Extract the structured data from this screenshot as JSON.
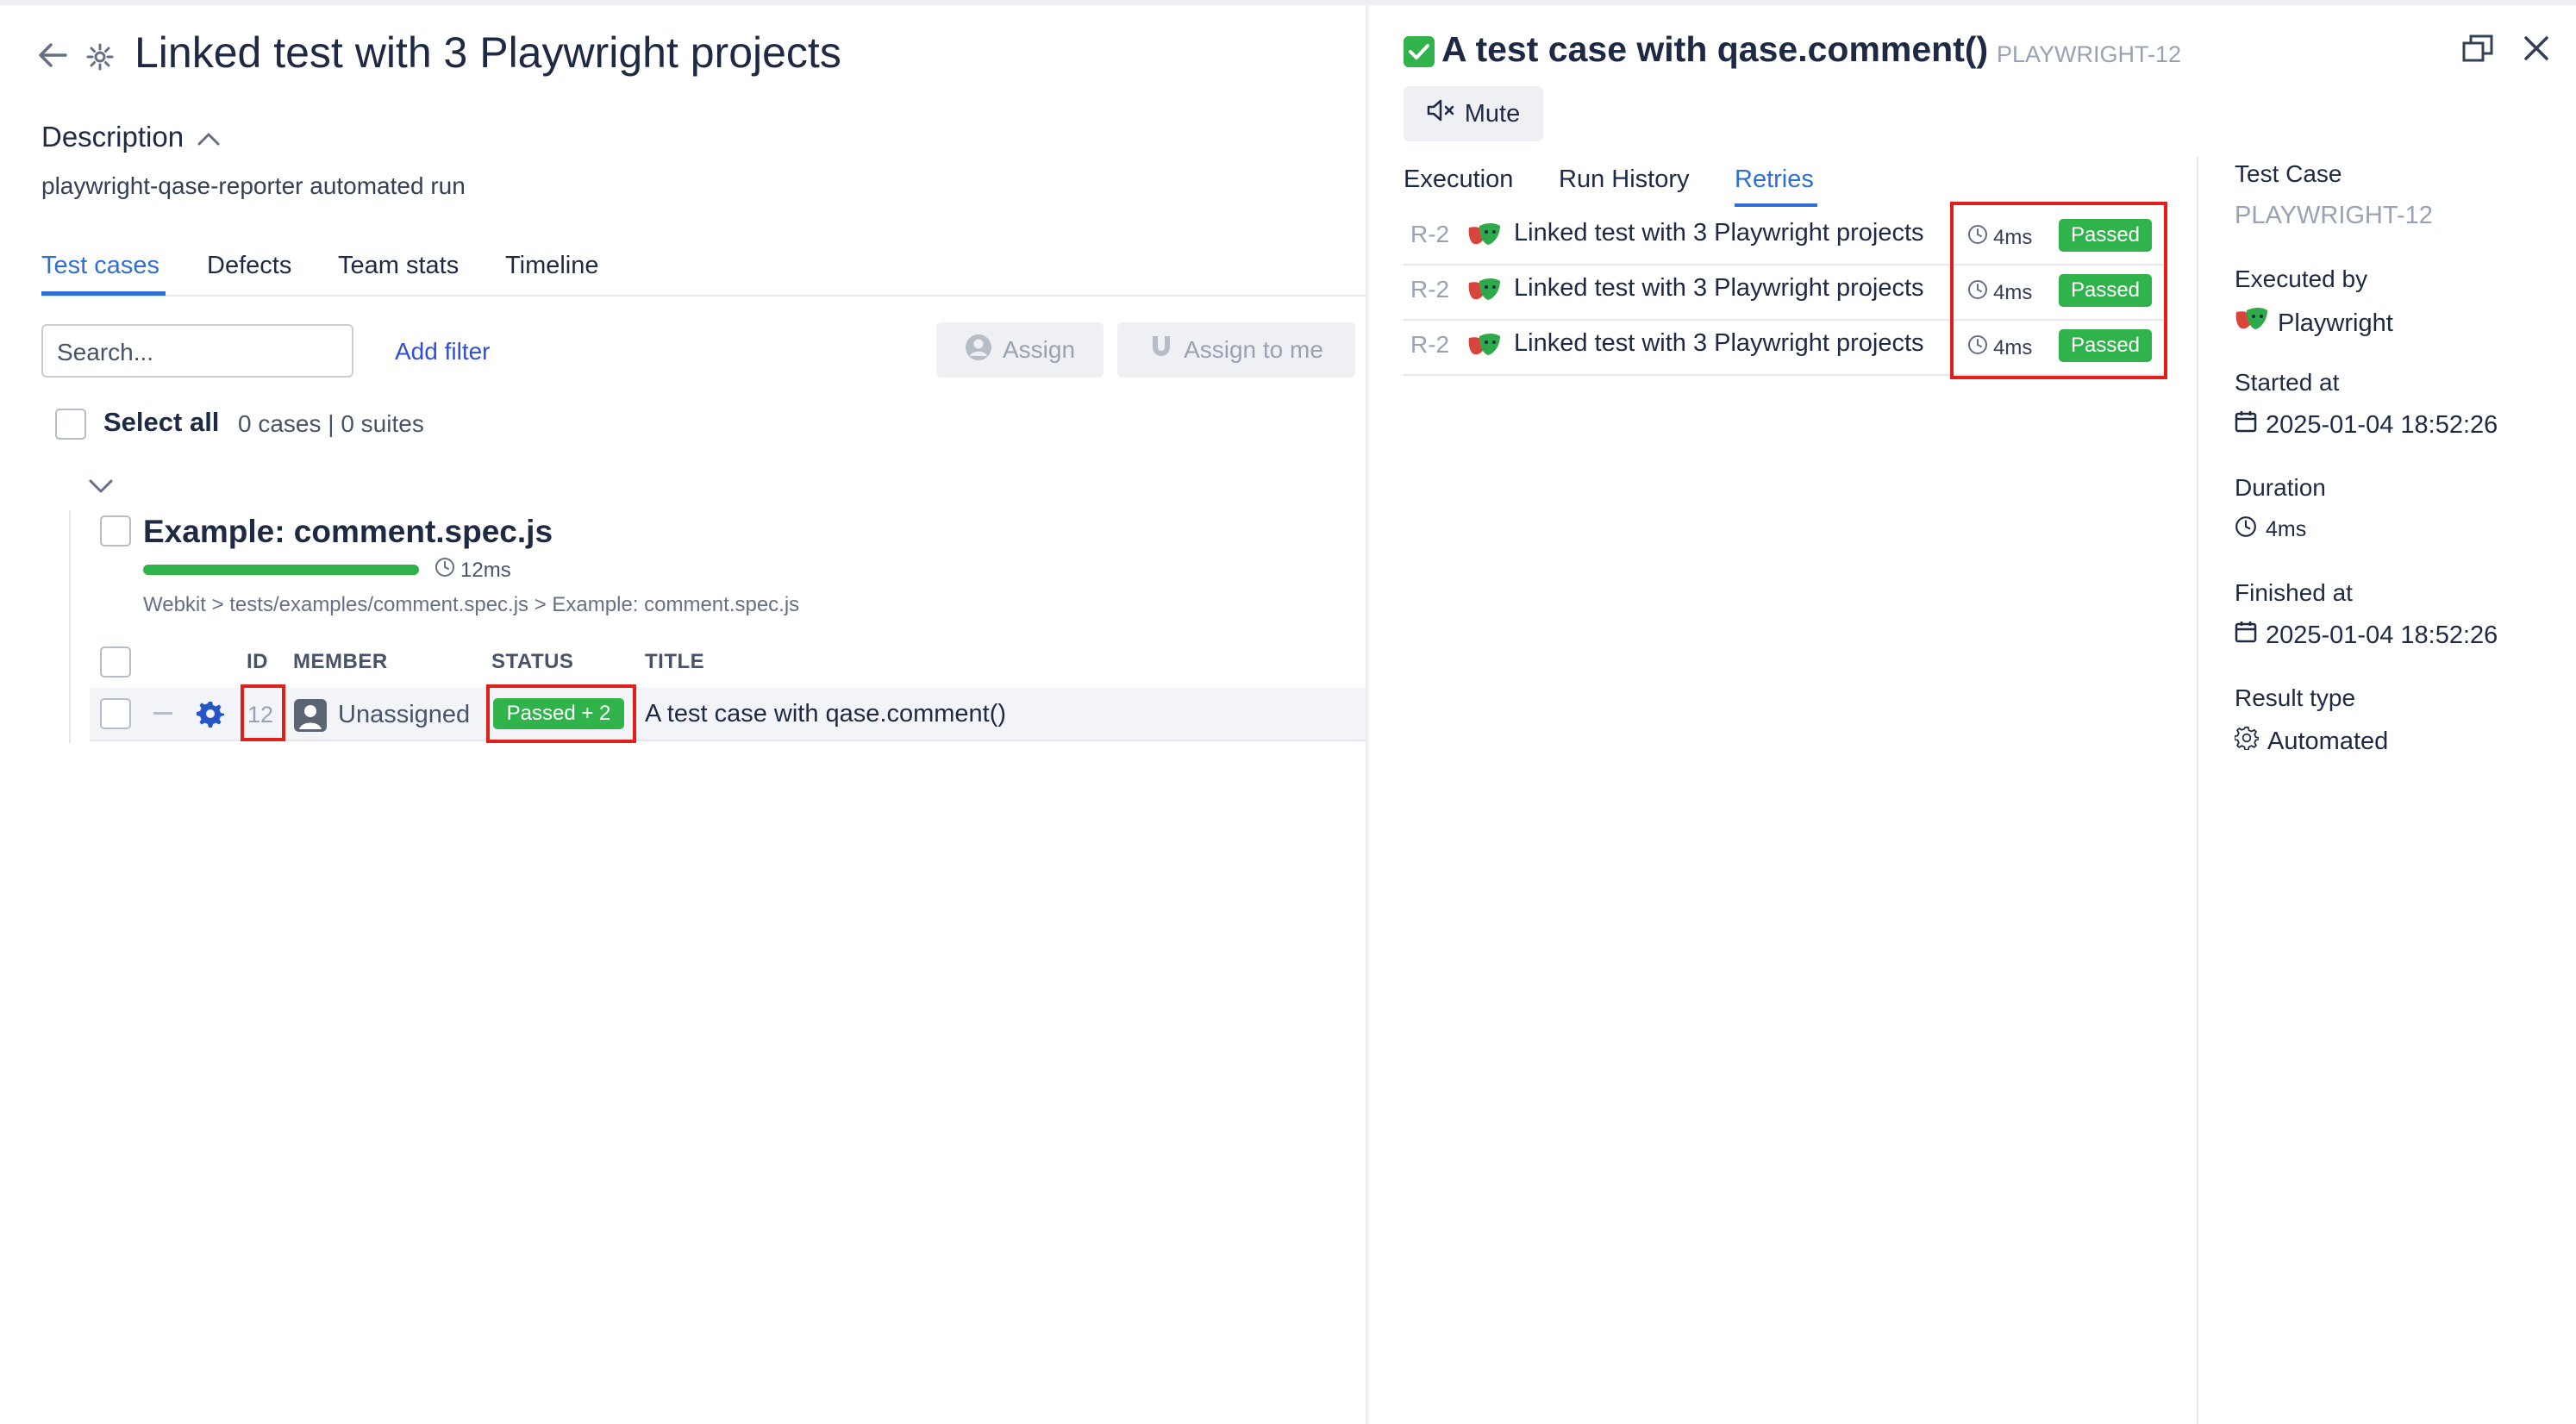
{
  "run": {
    "title": "Linked test with 3 Playwright projects",
    "description_heading": "Description",
    "description_text": "playwright-qase-reporter automated run",
    "tabs": [
      {
        "label": "Test cases",
        "active": true
      },
      {
        "label": "Defects",
        "active": false
      },
      {
        "label": "Team stats",
        "active": false
      },
      {
        "label": "Timeline",
        "active": false
      }
    ]
  },
  "toolbar": {
    "search_placeholder": "Search...",
    "add_filter_label": "Add filter",
    "assign_label": "Assign",
    "assign_to_me_label": "Assign to me"
  },
  "selection": {
    "select_all_label": "Select all",
    "count_text": "0 cases | 0 suites"
  },
  "suite": {
    "title": "Example: comment.spec.js",
    "progress_fraction": 1.0,
    "duration": "12ms",
    "breadcrumb": "Webkit > tests/examples/comment.spec.js > Example: comment.spec.js",
    "columns": [
      "ID",
      "MEMBER",
      "STATUS",
      "TITLE"
    ],
    "row": {
      "id": "12",
      "member": "Unassigned",
      "status": "Passed + 2",
      "title": "A test case with qase.comment()"
    }
  },
  "panel": {
    "title": "A test case with qase.comment()",
    "code": "PLAYWRIGHT-12",
    "mute_label": "Mute",
    "tabs": [
      {
        "label": "Execution",
        "active": false
      },
      {
        "label": "Run History",
        "active": false
      },
      {
        "label": "Retries",
        "active": true
      }
    ],
    "retries": [
      {
        "id": "R-2",
        "title": "Linked test with 3 Playwright projects",
        "time": "4ms",
        "status": "Passed"
      },
      {
        "id": "R-2",
        "title": "Linked test with 3 Playwright projects",
        "time": "4ms",
        "status": "Passed"
      },
      {
        "id": "R-2",
        "title": "Linked test with 3 Playwright projects",
        "time": "4ms",
        "status": "Passed"
      }
    ],
    "meta": {
      "test_case_label": "Test Case",
      "test_case_value": "PLAYWRIGHT-12",
      "executed_by_label": "Executed by",
      "executed_by_value": "Playwright",
      "started_at_label": "Started at",
      "started_at_value": "2025-01-04 18:52:26",
      "duration_label": "Duration",
      "duration_value": "4ms",
      "finished_at_label": "Finished at",
      "finished_at_value": "2025-01-04 18:52:26",
      "result_type_label": "Result type",
      "result_type_value": "Automated"
    }
  },
  "colors": {
    "accent": "#2f6fd6",
    "passed": "#2fb34a",
    "highlight": "#e0201a"
  }
}
